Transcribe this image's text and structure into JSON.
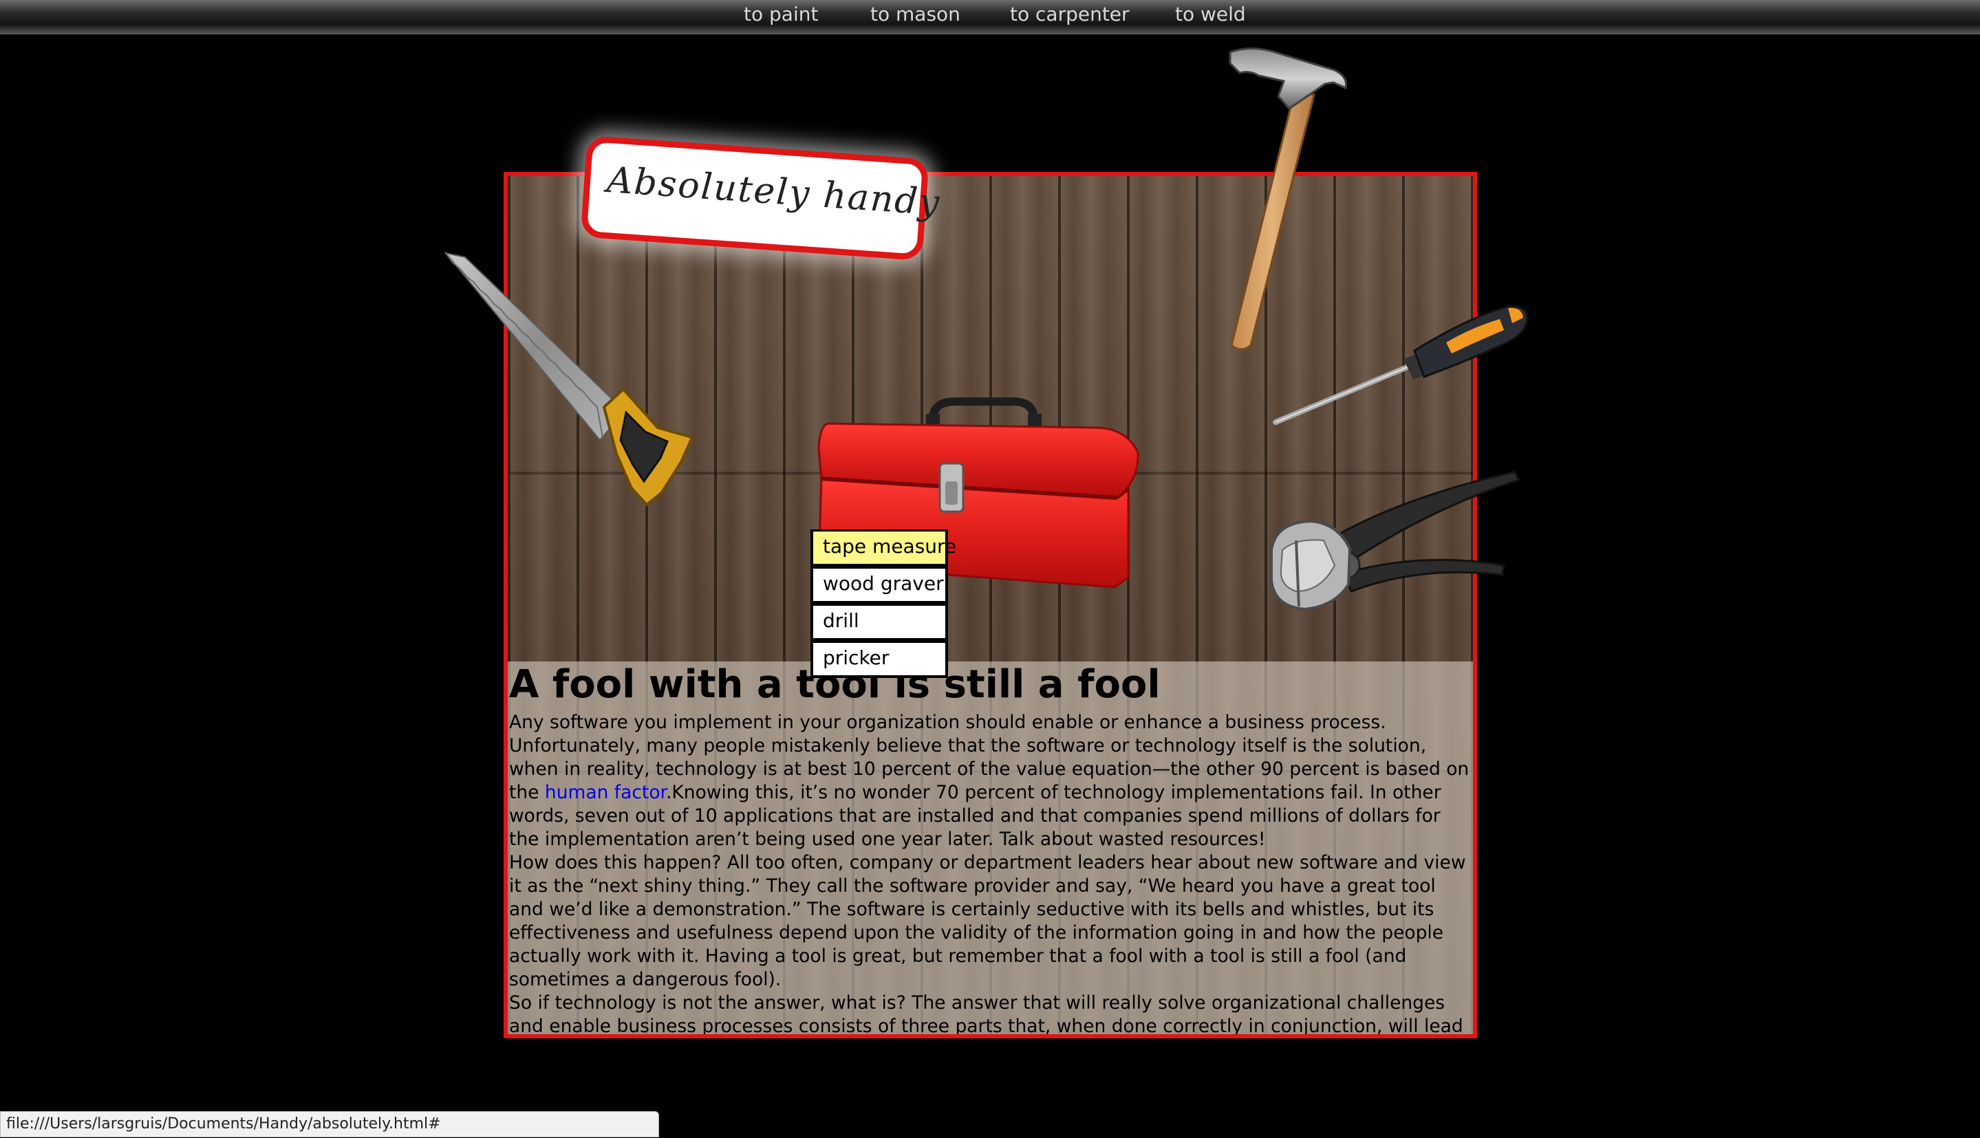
{
  "nav": {
    "items": [
      {
        "label": "to paint"
      },
      {
        "label": "to mason"
      },
      {
        "label": "to carpenter"
      },
      {
        "label": "to weld"
      }
    ]
  },
  "logo": {
    "text": "Absolutely handy"
  },
  "menu": {
    "items": [
      {
        "label": "tape measure",
        "active": true
      },
      {
        "label": "wood graver",
        "active": false
      },
      {
        "label": "drill",
        "active": false
      },
      {
        "label": "pricker",
        "active": false
      }
    ]
  },
  "article": {
    "heading": "A fool with a tool is still a fool",
    "p1_before": "Any software you implement in your organization should enable or enhance a business process. Unfortunately, many people mistakenly believe that the software or technology itself is the solution, when in reality, technology is at best 10 percent of the value equation—the other 90 percent is based on the ",
    "p1_link": "human factor",
    "p1_after": ".Knowing this, it’s no wonder 70 percent of technology implementations fail. In other words, seven out of 10 applications that are installed and that companies spend millions of dollars for the implementation aren’t being used one year later. Talk about wasted resources!",
    "p2": "How does this happen? All too often, company or department leaders hear about new software and view it as the “next shiny thing.” They call the software provider and say, “We heard you have a great tool and we’d like a demonstration.” The software is certainly seductive with its bells and whistles, but its effectiveness and usefulness depend upon the validity of the information going in and how the people actually work with it. Having a tool is great, but remember that a fool with a tool is still a fool (and sometimes a dangerous fool).",
    "p3": "So if technology is not the answer, what is? The answer that will really solve organizational challenges and enable business processes consists of three parts that, when done correctly in conjunction, will lead to long lasting results."
  },
  "status": {
    "url": "file:///Users/larsgruis/Documents/Handy/absolutely.html#"
  },
  "colors": {
    "frame": "#e01515",
    "menu_active": "#fff78a",
    "link": "#0000ee",
    "toolbox": "#e3201c"
  },
  "icons": [
    "saw-icon",
    "hammer-icon",
    "screwdriver-icon",
    "pincers-icon",
    "toolbox-icon"
  ]
}
